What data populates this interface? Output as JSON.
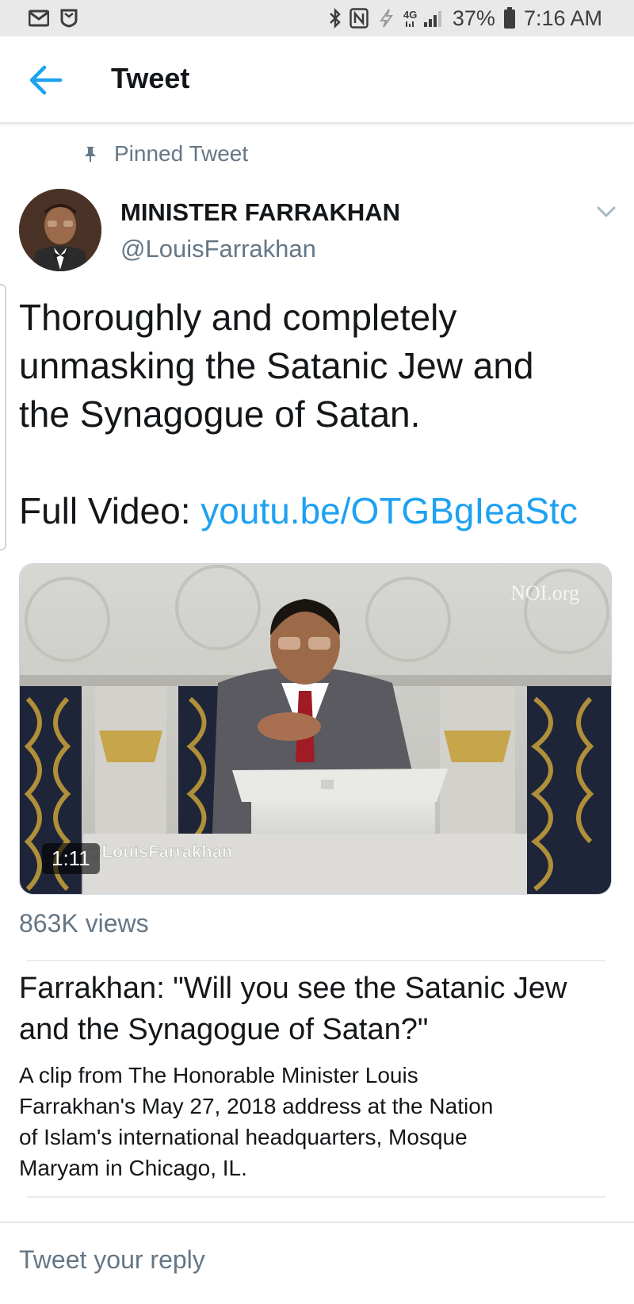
{
  "status_bar": {
    "battery_pct": "37%",
    "time": "7:16 AM",
    "network": "4G",
    "icons": [
      "mail-icon",
      "shield-icon",
      "bluetooth-icon",
      "nfc-icon",
      "data-icon",
      "signal-icon",
      "battery-icon"
    ]
  },
  "appbar": {
    "title": "Tweet",
    "back_icon": "back-arrow-icon"
  },
  "tweet": {
    "pinned_label": "Pinned Tweet",
    "author_name": "MINISTER FARRAKHAN",
    "author_handle": "@LouisFarrakhan",
    "text_lines": [
      "Thoroughly and completely",
      "unmasking the Satanic Jew and",
      "the Synagogue of Satan."
    ],
    "video_prefix": "Full Video: ",
    "video_link": "youtu.be/OTGBgIeaStc",
    "media": {
      "watermark": "NOI.org",
      "overlay_handle": "@LouisFarrakhan",
      "duration": "1:11"
    },
    "views": "863K views",
    "card": {
      "title_lines": [
        "Farrakhan: \"Will you see the Satanic Jew",
        "and the Synagogue of Satan?\""
      ],
      "description_lines": [
        "A clip from The Honorable Minister Louis",
        "Farrakhan's May 27, 2018 address at the Nation",
        "of Islam's international headquarters, Mosque",
        "Maryam in Chicago, IL."
      ]
    }
  },
  "reply": {
    "placeholder": "Tweet your reply"
  },
  "colors": {
    "accent": "#1da1f2",
    "secondary_text": "#657786",
    "primary_text": "#14171a"
  }
}
